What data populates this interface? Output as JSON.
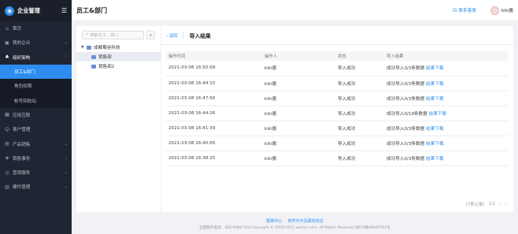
{
  "brand": {
    "name": "企业管理",
    "collapse_icon": "menu-fold-icon"
  },
  "sidebar": {
    "items": [
      {
        "label": "首页",
        "icon": "home-icon",
        "chev": ""
      },
      {
        "label": "我的企业",
        "icon": "building-icon",
        "chev": "⌄"
      },
      {
        "label": "组织架构",
        "icon": "org-icon",
        "chev": "⌃"
      },
      {
        "label": "应用互联",
        "icon": "apps-icon",
        "chev": ""
      },
      {
        "label": "客户管理",
        "icon": "customer-icon",
        "chev": ""
      },
      {
        "label": "产品销售",
        "icon": "product-icon",
        "chev": "⌄"
      },
      {
        "label": "销售事务",
        "icon": "sales-icon",
        "chev": "⌄"
      },
      {
        "label": "营销服务",
        "icon": "marketing-icon",
        "chev": "⌄"
      },
      {
        "label": "硬件管理",
        "icon": "hardware-icon",
        "chev": "⌄"
      }
    ],
    "sub_items": [
      {
        "label": "员工&部门"
      },
      {
        "label": "角色权限"
      },
      {
        "label": "帐号回收站"
      }
    ]
  },
  "header": {
    "title": "员工&部门",
    "support": "联系客服",
    "user": "kiki酱"
  },
  "tree": {
    "search_placeholder": "搜索员工、部门",
    "add_label": "+",
    "root": "成都蜀谷科技",
    "children": [
      "销售部",
      "销售部2"
    ]
  },
  "main": {
    "back": "返回",
    "title": "导入结果",
    "columns": [
      "操作时间",
      "操作人",
      "状态",
      "导入结果"
    ],
    "download_label": "结果下载",
    "rows": [
      {
        "time": "2021-03-08 16:50:09",
        "operator": "kiki酱",
        "status": "导入成功",
        "result": "成功导入3/3条数据"
      },
      {
        "time": "2021-03-08 16:49:15",
        "operator": "kiki酱",
        "status": "导入成功",
        "result": "成功导入0/3条数据"
      },
      {
        "time": "2021-03-08 16:47:56",
        "operator": "kiki酱",
        "status": "导入成功",
        "result": "成功导入0/3条数据"
      },
      {
        "time": "2021-03-08 16:44:26",
        "operator": "kiki酱",
        "status": "导入成功",
        "result": "成功导入0/19条数据"
      },
      {
        "time": "2021-03-08 16:41:39",
        "operator": "kiki酱",
        "status": "导入成功",
        "result": "成功导入0/3条数据"
      },
      {
        "time": "2021-03-08 16:40:00",
        "operator": "kiki酱",
        "status": "导入成功",
        "result": "成功导入0/3条数据"
      },
      {
        "time": "2021-03-08 16:38:25",
        "operator": "kiki酱",
        "status": "导入成功",
        "result": "成功导入0/3条数据"
      }
    ],
    "pager": {
      "total": "(7条记录)",
      "page": "1/1",
      "prev": "‹",
      "next": "›"
    }
  },
  "footer": {
    "links": [
      "帮助中心",
      "软件许可及服务协议"
    ],
    "copyright": "全国服务电话：400-0060-100 Copyright © 2009-2021 wortec.com. All Rights Reserved.浙ICP备09049701号"
  },
  "colors": {
    "accent": "#2d8cf0",
    "sidebar_bg": "#1f2533",
    "active_bg": "#2d8cf0"
  }
}
